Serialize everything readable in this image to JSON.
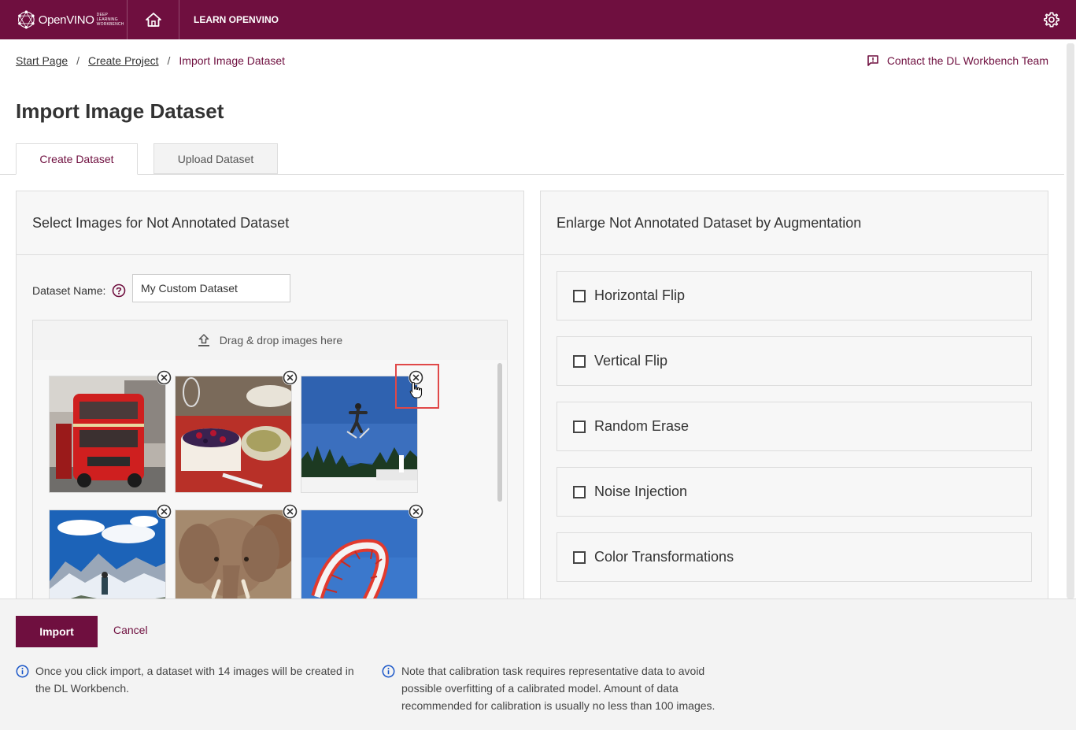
{
  "app": {
    "logo_text": "OpenVINO",
    "logo_sub_1": "DEEP LEARNING",
    "logo_sub_2": "WORKBENCH",
    "learn_label": "LEARN OPENVINO",
    "brand_color": "#6f0f3f"
  },
  "breadcrumb": {
    "items": [
      "Start Page",
      "Create Project",
      "Import Image Dataset"
    ],
    "separator": "/"
  },
  "contact_label": "Contact the DL Workbench Team",
  "page_title": "Import Image Dataset",
  "tabs": [
    {
      "label": "Create Dataset",
      "active": true
    },
    {
      "label": "Upload Dataset",
      "active": false
    }
  ],
  "left_panel": {
    "title": "Select Images for Not Annotated Dataset",
    "dataset_name_label": "Dataset Name:",
    "dataset_name_value": "My Custom Dataset",
    "drop_label": "Drag & drop images here",
    "images": [
      {
        "name": "red-double-decker-bus"
      },
      {
        "name": "cake-and-table"
      },
      {
        "name": "ski-jumper"
      },
      {
        "name": "snowy-mountain-hiker"
      },
      {
        "name": "elephant"
      },
      {
        "name": "kite"
      }
    ]
  },
  "right_panel": {
    "title": "Enlarge Not Annotated Dataset by Augmentation",
    "options": [
      {
        "label": "Horizontal Flip",
        "checked": false
      },
      {
        "label": "Vertical Flip",
        "checked": false
      },
      {
        "label": "Random Erase",
        "checked": false
      },
      {
        "label": "Noise Injection",
        "checked": false
      },
      {
        "label": "Color Transformations",
        "checked": false
      }
    ]
  },
  "footer": {
    "import_label": "Import",
    "cancel_label": "Cancel",
    "info_1": "Once you click import, a dataset with 14 images will be created in the DL Workbench.",
    "info_2": "Note that calibration task requires representative data to avoid possible overfitting of a calibrated model. Amount of data recommended for calibration is usually no less than 100 images."
  }
}
